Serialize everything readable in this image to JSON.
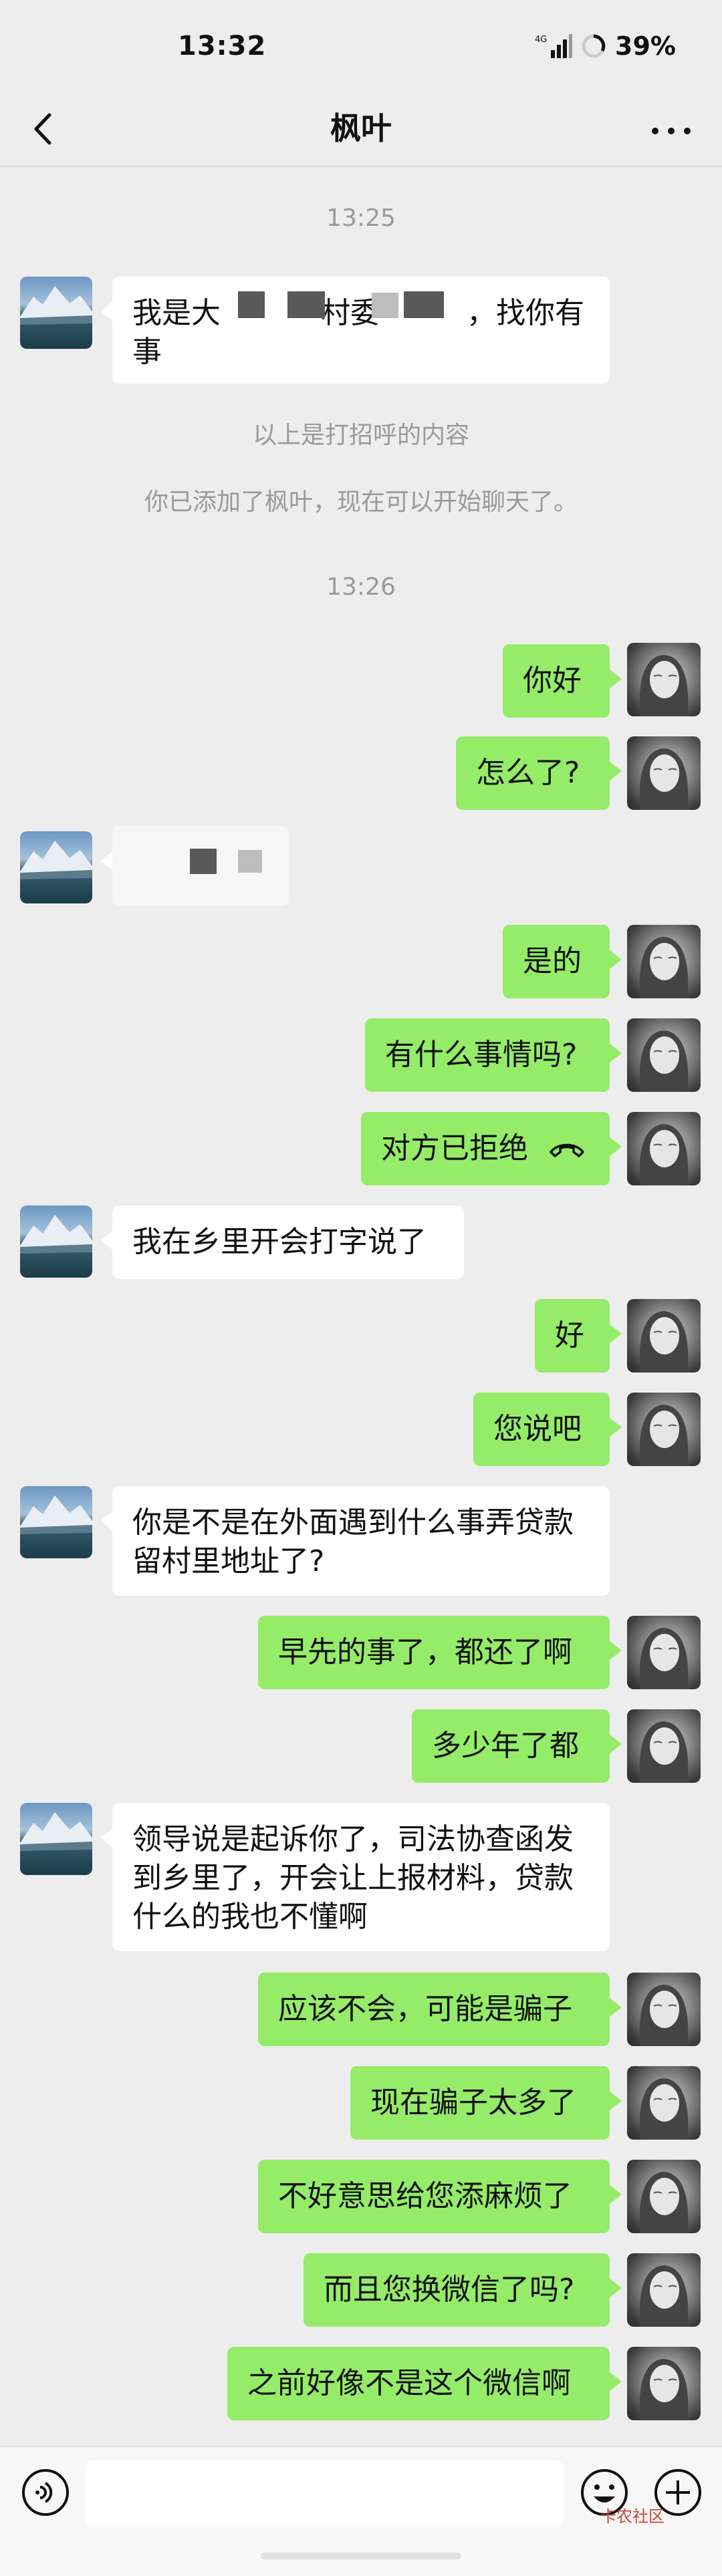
{
  "status_bar": {
    "time": "13:32",
    "battery": "39%"
  },
  "header": {
    "title": "枫叶"
  },
  "chat": {
    "timestamp_1": "13:25",
    "greeting_content_note": "以上是打招呼的内容",
    "added_friend_note": "你已添加了枫叶，现在可以开始聊天了。",
    "timestamp_2": "13:26",
    "messages": [
      {
        "side": "in",
        "text_part1": "我是大",
        "text_part2": "村委",
        "text_part3": "，找你有",
        "text_part4": "事"
      },
      {
        "side": "out",
        "text": "你好"
      },
      {
        "side": "out",
        "text": "怎么了?"
      },
      {
        "side": "in",
        "text": ""
      },
      {
        "side": "out",
        "text": "是的"
      },
      {
        "side": "out",
        "text": "有什么事情吗?"
      },
      {
        "side": "out",
        "text": "对方已拒绝",
        "icon": "hangup-icon"
      },
      {
        "side": "in",
        "text": "我在乡里开会打字说了"
      },
      {
        "side": "out",
        "text": "好"
      },
      {
        "side": "out",
        "text": "您说吧"
      },
      {
        "side": "in",
        "text_line1": "你是不是在外面遇到什么事弄贷款",
        "text_line2": "留村里地址了?"
      },
      {
        "side": "out",
        "text": "早先的事了，都还了啊"
      },
      {
        "side": "out",
        "text": "多少年了都"
      },
      {
        "side": "in",
        "text_line1": "领导说是起诉你了，司法协查函发",
        "text_line2": "到乡里了，开会让上报材料，贷款",
        "text_line3": "什么的我也不懂啊"
      },
      {
        "side": "out",
        "text": "应该不会，可能是骗子"
      },
      {
        "side": "out",
        "text": "现在骗子太多了"
      },
      {
        "side": "out",
        "text": "不好意思给您添麻烦了"
      },
      {
        "side": "out",
        "text": "而且您换微信了吗?"
      },
      {
        "side": "out",
        "text": "之前好像不是这个微信啊"
      }
    ]
  },
  "input_bar": {
    "watermark": "卡农社区"
  },
  "colors": {
    "outgoing_bubble": "#95ec69",
    "incoming_bubble": "#ffffff",
    "background": "#ededed"
  }
}
